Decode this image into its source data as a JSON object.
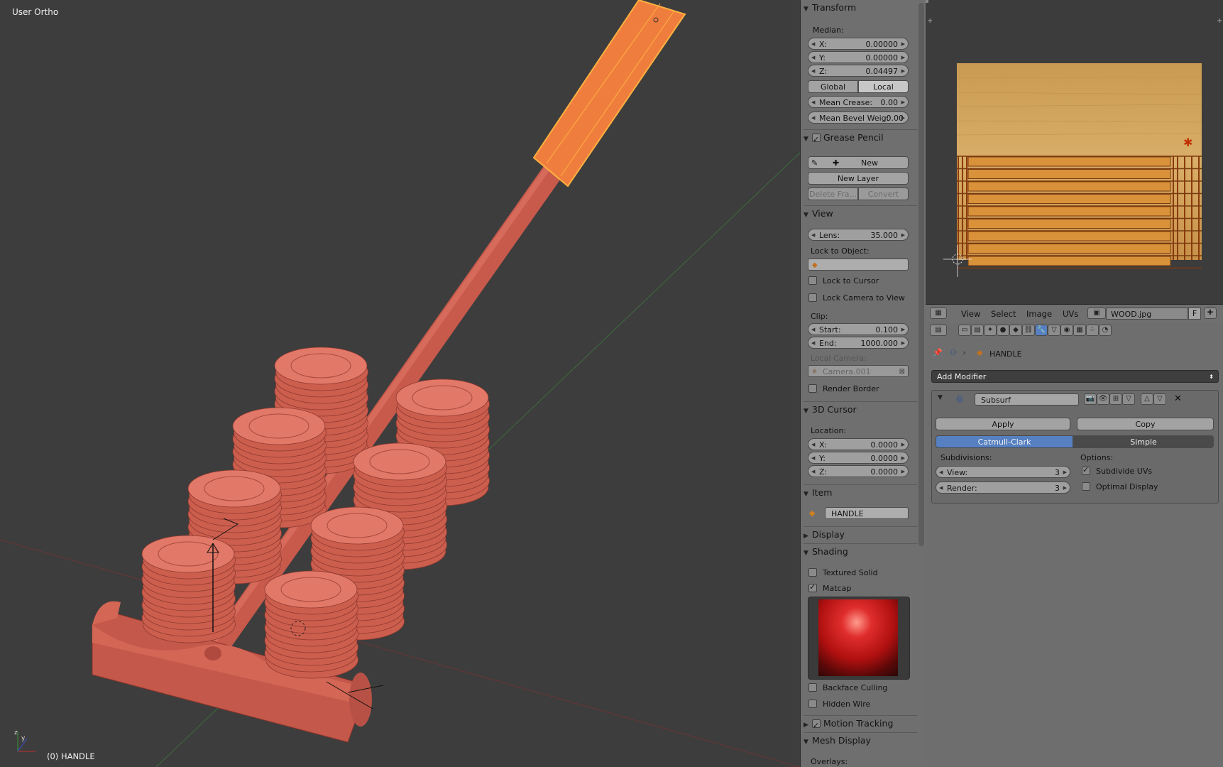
{
  "viewport": {
    "view_label": "User Ortho",
    "object_label": "(0) HANDLE"
  },
  "npanel": {
    "transform": {
      "header": "Transform",
      "median_label": "Median:",
      "x_key": "X:",
      "x_val": "0.00000",
      "y_key": "Y:",
      "y_val": "0.00000",
      "z_key": "Z:",
      "z_val": "0.04497",
      "global": "Global",
      "local": "Local",
      "crease_key": "Mean Crease:",
      "crease_val": "0.00",
      "bevel_key": "Mean Bevel Weig:",
      "bevel_val": "0.00"
    },
    "grease": {
      "header": "Grease Pencil",
      "new": "New",
      "new_layer": "New Layer",
      "delete_frame": "Delete Fra...",
      "convert": "Convert"
    },
    "view": {
      "header": "View",
      "lens_key": "Lens:",
      "lens_val": "35.000",
      "lock_object": "Lock to Object:",
      "lock_cursor": "Lock to Cursor",
      "lock_camera": "Lock Camera to View",
      "clip": "Clip:",
      "start_key": "Start:",
      "start_val": "0.100",
      "end_key": "End:",
      "end_val": "1000.000",
      "local_camera": "Local Camera:",
      "camera_val": "Camera.001",
      "render_border": "Render Border"
    },
    "cursor": {
      "header": "3D Cursor",
      "location": "Location:",
      "x_key": "X:",
      "x_val": "0.0000",
      "y_key": "Y:",
      "y_val": "0.0000",
      "z_key": "Z:",
      "z_val": "0.0000"
    },
    "item": {
      "header": "Item",
      "name": "HANDLE"
    },
    "display": {
      "header": "Display"
    },
    "shading": {
      "header": "Shading",
      "textured_solid": "Textured Solid",
      "matcap": "Matcap",
      "backface": "Backface Culling",
      "hidden_wire": "Hidden Wire"
    },
    "motion": {
      "header": "Motion Tracking"
    },
    "mesh": {
      "header": "Mesh Display",
      "overlays": "Overlays:"
    }
  },
  "uv_header": {
    "view": "View",
    "select": "Select",
    "image": "Image",
    "uvs": "UVs",
    "image_name": "WOOD.jpg",
    "fake": "F"
  },
  "props": {
    "object": "HANDLE",
    "add_modifier": "Add Modifier",
    "modifier_name": "Subsurf",
    "apply": "Apply",
    "copy": "Copy",
    "catmull": "Catmull-Clark",
    "simple": "Simple",
    "subdivisions": "Subdivisions:",
    "options": "Options:",
    "view_key": "View:",
    "view_val": "3",
    "render_key": "Render:",
    "render_val": "3",
    "subdivide_uvs": "Subdivide UVs",
    "optimal": "Optimal Display"
  },
  "colors": {
    "viewport_bg": "#3d3d3d",
    "object": "#d86a58",
    "selected": "#f08a3a",
    "panel_bg": "#6f6f6f",
    "accent": "#5680c2"
  }
}
